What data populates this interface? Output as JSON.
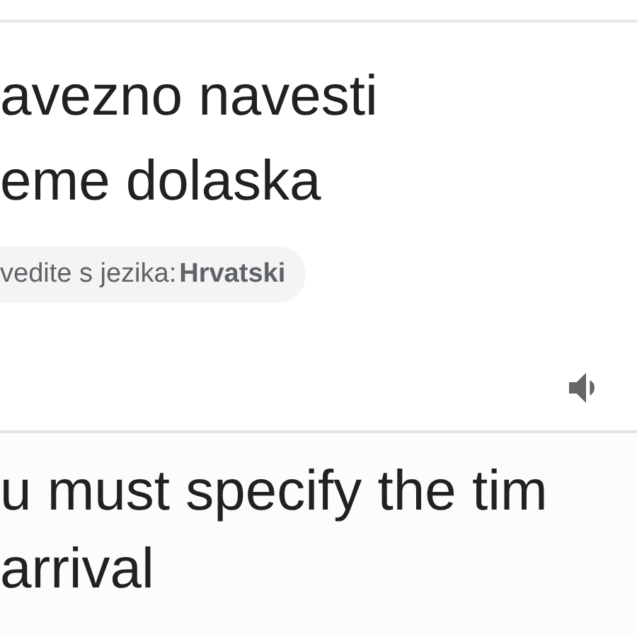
{
  "source": {
    "lines": [
      "avezno navesti",
      "eme dolaska"
    ]
  },
  "detected_language": {
    "prefix": "vedite s jezika:",
    "language": "Hrvatski"
  },
  "translation": {
    "lines": [
      "u must specify the tim",
      "arrival"
    ]
  }
}
